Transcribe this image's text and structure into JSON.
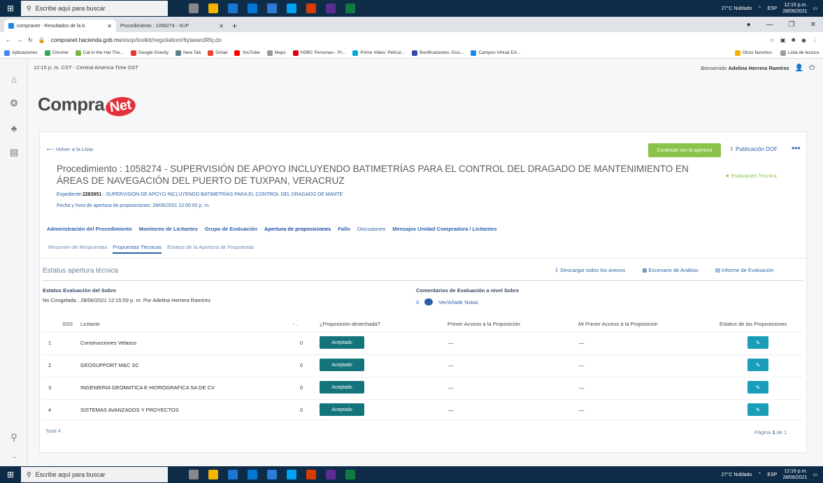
{
  "taskbar": {
    "search_placeholder": "Escribe aquí para buscar",
    "weather": "27°C Nublado",
    "lang": "ESP",
    "time": "12:15 p.m.",
    "date": "28/06/2021",
    "bottom_time": "12:16 p.m.",
    "bottom_date": "28/06/2021"
  },
  "browser": {
    "tabs": [
      {
        "label": "compranet - Resultados de la b"
      },
      {
        "label": "Procedimiento : 1058274 - SUP"
      }
    ],
    "url_host": "compranet.hacienda.gob.mx",
    "url_path": "/esop/toolkit/negotiation/rfq/awardRfq.do",
    "bookmarks": [
      {
        "label": "Aplicaciones",
        "color": "#4285f4"
      },
      {
        "label": "Chrome",
        "color": "#34a853"
      },
      {
        "label": "Cat in the Hat The...",
        "color": "#7cb342"
      },
      {
        "label": "Google Gravity",
        "color": "#e53935"
      },
      {
        "label": "New Tab",
        "color": "#607d8b"
      },
      {
        "label": "Gmail",
        "color": "#ea4335"
      },
      {
        "label": "YouTube",
        "color": "#ff0000"
      },
      {
        "label": "Maps",
        "color": "#999999"
      },
      {
        "label": "HSBC Personas - Pr...",
        "color": "#db0011"
      },
      {
        "label": "Prime Video: Películ...",
        "color": "#00a8e1"
      },
      {
        "label": "Bonificaciones: Goo...",
        "color": "#3949ab"
      },
      {
        "label": "Campus Virtual EA...",
        "color": "#1e88e5"
      }
    ],
    "other_favorites": "Otros favoritos",
    "reading_list": "Lista de lectura"
  },
  "header": {
    "timezone": "12:15 p. m. CST - Central America Time DST",
    "welcome_prefix": "Bienvenido",
    "user": "Adelina Herrera Ramírez",
    "logo_a": "Compra",
    "logo_b": "Net"
  },
  "card": {
    "back": "Volver a la Lista",
    "green_button": "Continuar con la apertura",
    "publicacion": "Publicación DOF",
    "more": "•••",
    "title": "Procedimiento : 1058274 - SUPERVISIÓN DE APOYO INCLUYENDO BATIMETRÍAS PARA EL CONTROL DEL DRAGADO DE MANTENIMIENTO EN ÁREAS DE NAVEGACIÓN DEL PUERTO DE TUXPAN, VERACRUZ",
    "evaluacion_tecnica": "Evaluación Técnica",
    "expediente_label": "Expediente:",
    "expediente_num": "2283951",
    "expediente_text": "- SUPERVISIÓN DE APOYO INCLUYENDO BATIMETRÍAS PARA EL CONTROL DEL DRAGADO DE MANTE",
    "fecha": "Fecha y hora de apertura de proposiciones: 28/06/2021 12:00:00 p. m.",
    "tabs": [
      "Administración del Procedimiento",
      "Monitoreo de Licitantes",
      "Grupo de Evaluación",
      "Apertura de proposiciones",
      "Fallo",
      "Discusiones",
      "Mensajes Unidad Compradora / Licitantes"
    ],
    "subtabs": [
      "Resumen de Respuestas",
      "Propuestas Técnicas",
      "Estatus de la Apertura de Propuestas"
    ],
    "section_title": "Estatus apertura técnica",
    "actions": [
      "Descargar todos los anexos",
      "Escenario de Análisis",
      "Informe de Evaluación"
    ],
    "status_label": "Estatus Evaluación del Sobre",
    "status_value": "No Congelada , 28/06/2021 12:15:59 p. m.  Por Adelina Herrera Ramírez",
    "comments_label": "Comentarios de Evaluación a nivel Sobre",
    "comments_count": "0",
    "comments_link": "Ver/Añadir Notas",
    "columns": {
      "sss": "SSS",
      "licitante": "Licitante",
      "num": "- .",
      "desechada": "¿Proposición desechada?",
      "primer_acceso": "Primer Acceso a la Proposición",
      "mi_primer": "Mi Primer Acceso a la Proposición",
      "estatus": "Estatus de las Proposiciones"
    },
    "rows": [
      {
        "n": "1",
        "name": "Construcciones Velasco",
        "count": "0",
        "status": "Aceptado",
        "first": "—",
        "mine": "—"
      },
      {
        "n": "2",
        "name": "GEOSUPPORT M&C SC",
        "count": "0",
        "status": "Aceptado",
        "first": "—",
        "mine": "—"
      },
      {
        "n": "3",
        "name": "INGENIERIA GEOMATICA E HIDROGRAFICA SA DE CV",
        "count": "0",
        "status": "Aceptado",
        "first": "—",
        "mine": "—"
      },
      {
        "n": "4",
        "name": "SISTEMAS AVANZADOS Y PROYECTOS",
        "count": "0",
        "status": "Aceptado",
        "first": "—",
        "mine": "—"
      }
    ],
    "total": "Total 4",
    "pagina_prefix": "Página",
    "pagina_num": "1",
    "pagina_suffix": "de 1"
  }
}
